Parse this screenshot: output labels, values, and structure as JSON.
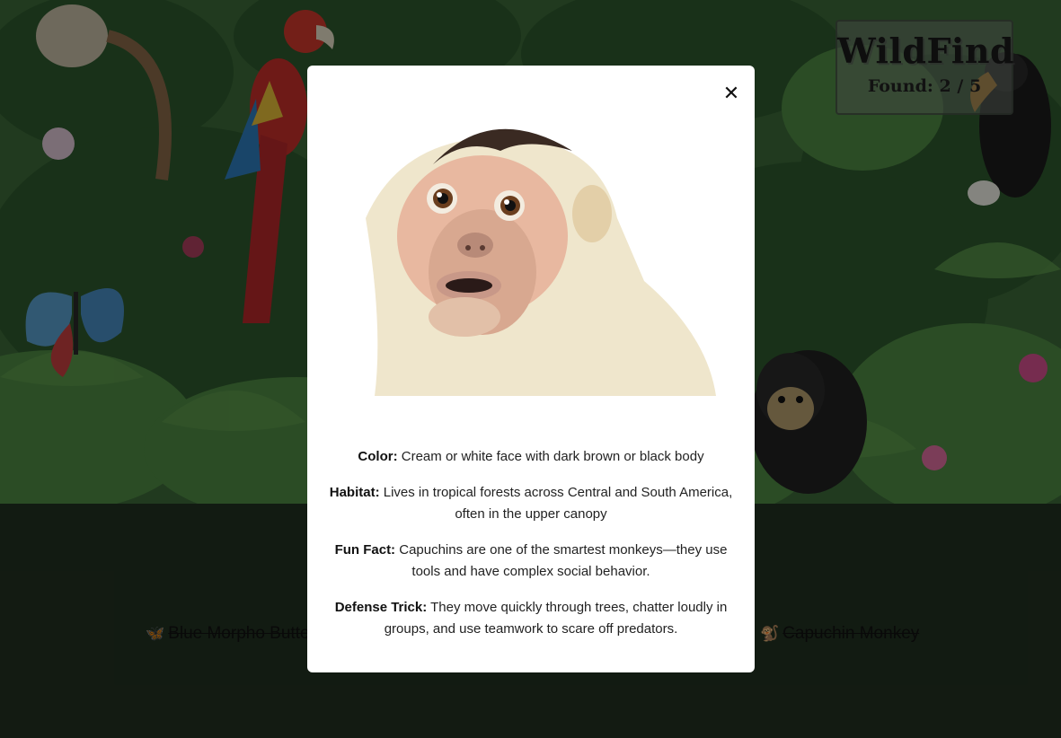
{
  "game": {
    "logo": "WildFind",
    "found_label": "Found:",
    "found_count": "2",
    "found_separator": "/",
    "found_total": "5"
  },
  "modal": {
    "close_symbol": "✕",
    "photo_icon": "capuchin-monkey-photo",
    "facts": [
      {
        "label": "Color:",
        "text": "Cream or white face with dark brown or black body"
      },
      {
        "label": "Habitat:",
        "text": "Lives in tropical forests across Central and South America, often in the upper canopy"
      },
      {
        "label": "Fun Fact:",
        "text": "Capuchins are one of the smartest monkeys—they use tools and have complex social behavior."
      },
      {
        "label": "Defense Trick:",
        "text": "They move quickly through trees, chatter loudly in groups, and use teamwork to scare off predators."
      }
    ]
  },
  "animal_list": [
    {
      "icon": "🦋",
      "name": "Blue Morpho Butte",
      "found": true
    },
    {
      "icon": "🐒",
      "name": "Capuchin Monkey",
      "found": true
    }
  ],
  "colors": {
    "footer_bg": "#223221",
    "modal_bg": "#ffffff",
    "panel_bg": "#7a8278"
  }
}
